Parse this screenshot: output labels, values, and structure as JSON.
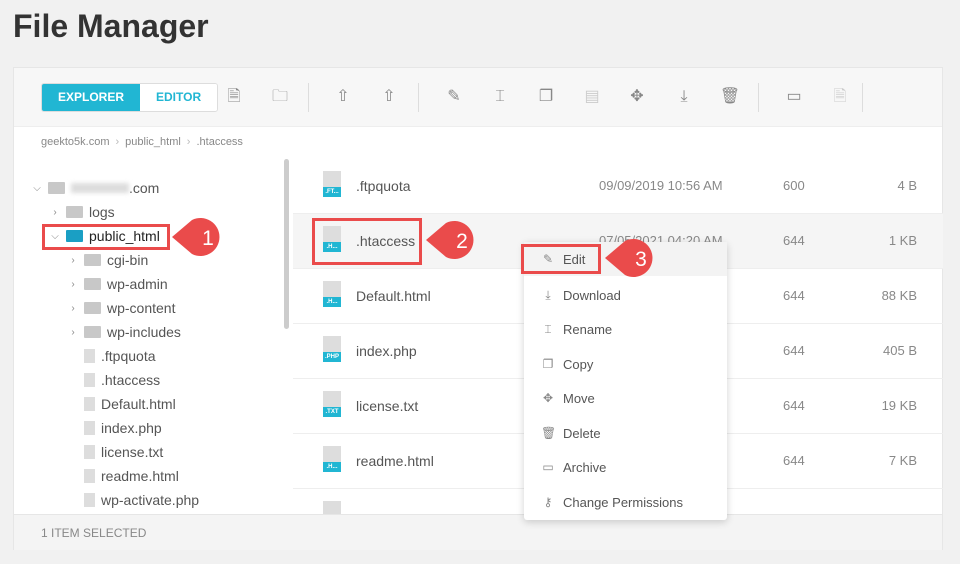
{
  "page_title": "File Manager",
  "toolbar": {
    "explorer": "EXPLORER",
    "editor": "EDITOR"
  },
  "breadcrumb": [
    "geekto5k.com",
    "public_html",
    ".htaccess"
  ],
  "tree": [
    {
      "label": ".com",
      "type": "root",
      "expanded": true
    },
    {
      "label": "logs",
      "type": "folder"
    },
    {
      "label": "public_html",
      "type": "folder",
      "expanded": true,
      "selected": true
    },
    {
      "label": "cgi-bin",
      "type": "folder"
    },
    {
      "label": "wp-admin",
      "type": "folder"
    },
    {
      "label": "wp-content",
      "type": "folder"
    },
    {
      "label": "wp-includes",
      "type": "folder"
    },
    {
      "label": ".ftpquota",
      "type": "file"
    },
    {
      "label": ".htaccess",
      "type": "file"
    },
    {
      "label": "Default.html",
      "type": "file"
    },
    {
      "label": "index.php",
      "type": "file"
    },
    {
      "label": "license.txt",
      "type": "file"
    },
    {
      "label": "readme.html",
      "type": "file"
    },
    {
      "label": "wp-activate.php",
      "type": "file"
    }
  ],
  "files": [
    {
      "ext": ".FT...",
      "name": ".ftpquota",
      "date": "09/09/2019 10:56 AM",
      "perm": "600",
      "size": "4 B"
    },
    {
      "ext": ".H...",
      "name": ".htaccess",
      "date": "07/05/2021 04:20 AM",
      "perm": "644",
      "size": "1 KB"
    },
    {
      "ext": ".H...",
      "name": "Default.html",
      "date": "",
      "perm": "644",
      "size": "88 KB"
    },
    {
      "ext": ".PHP",
      "name": "index.php",
      "date": "",
      "perm": "644",
      "size": "405 B"
    },
    {
      "ext": ".TXT",
      "name": "license.txt",
      "date": "",
      "perm": "644",
      "size": "19 KB"
    },
    {
      "ext": ".H...",
      "name": "readme.html",
      "date": "",
      "perm": "644",
      "size": "7 KB"
    }
  ],
  "context_menu": [
    {
      "label": "Edit",
      "icon": "pencil-icon"
    },
    {
      "label": "Download",
      "icon": "download-icon"
    },
    {
      "label": "Rename",
      "icon": "rename-icon"
    },
    {
      "label": "Copy",
      "icon": "copy-icon"
    },
    {
      "label": "Move",
      "icon": "move-icon"
    },
    {
      "label": "Delete",
      "icon": "trash-icon"
    },
    {
      "label": "Archive",
      "icon": "archive-icon"
    },
    {
      "label": "Change Permissions",
      "icon": "key-icon"
    }
  ],
  "status": "1 ITEM SELECTED",
  "callouts": [
    "1",
    "2",
    "3"
  ],
  "colors": {
    "accent": "#21b6d3",
    "highlight": "#ea4b4b"
  }
}
